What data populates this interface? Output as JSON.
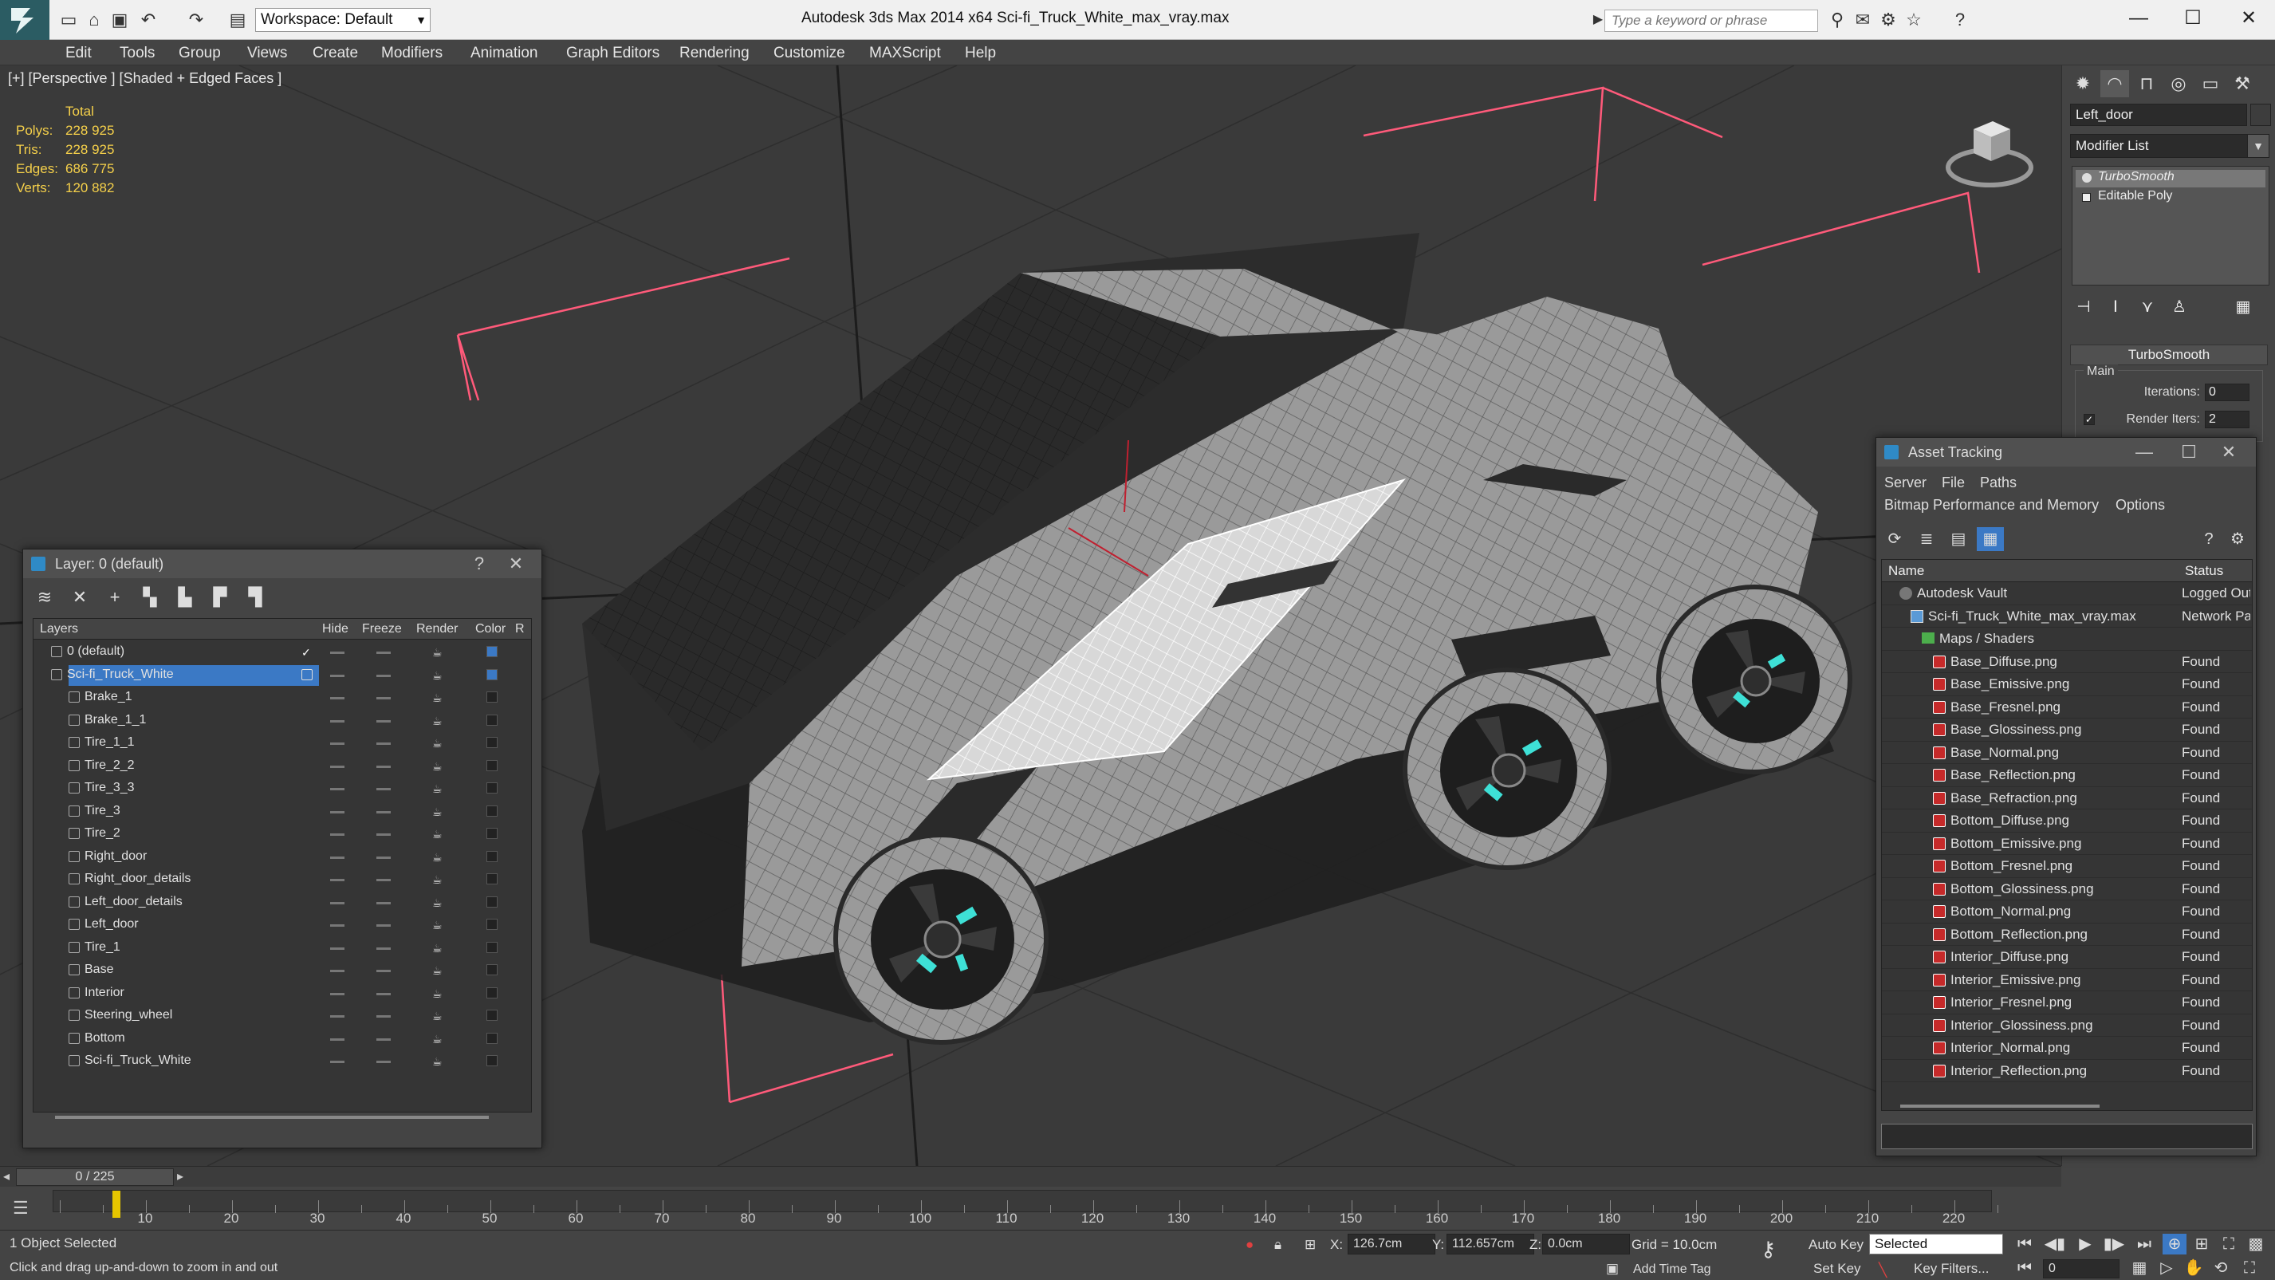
{
  "titlebar": {
    "workspace_label": "Workspace: Default",
    "title": "Autodesk 3ds Max  2014 x64       Sci-fi_Truck_White_max_vray.max",
    "search_placeholder": "Type a keyword or phrase"
  },
  "menu": [
    "Edit",
    "Tools",
    "Group",
    "Views",
    "Create",
    "Modifiers",
    "Animation",
    "Graph Editors",
    "Rendering",
    "Customize",
    "MAXScript",
    "Help"
  ],
  "viewport": {
    "label": "[+] [Perspective ] [Shaded + Edged Faces ]",
    "stats": {
      "header": "Total",
      "rows": [
        {
          "key": "Polys:",
          "value": "228 925"
        },
        {
          "key": "Tris:",
          "value": "228 925"
        },
        {
          "key": "Edges:",
          "value": "686 775"
        },
        {
          "key": "Verts:",
          "value": "120 882"
        }
      ]
    }
  },
  "command_panel": {
    "object_name": "Left_door",
    "modifier_list": "Modifier List",
    "stack": [
      {
        "label": "TurboSmooth",
        "selected": true
      },
      {
        "label": "Editable Poly",
        "selected": false
      }
    ],
    "rollout_title": "TurboSmooth",
    "group_label": "Main",
    "iterations_label": "Iterations:",
    "iterations_value": "0",
    "render_iters_label": "Render Iters:",
    "render_iters_value": "2"
  },
  "layers_dialog": {
    "title": "Layer: 0 (default)",
    "help": "?",
    "close": "✕",
    "columns": {
      "layers": "Layers",
      "hide": "Hide",
      "freeze": "Freeze",
      "render": "Render",
      "color": "Color",
      "radiosity": "R"
    },
    "rows": [
      {
        "name": "0 (default)",
        "level": 0
      },
      {
        "name": "Sci-fi_Truck_White",
        "level": 0,
        "selected": true
      },
      {
        "name": "Brake_1",
        "level": 1
      },
      {
        "name": "Brake_1_1",
        "level": 1
      },
      {
        "name": "Tire_1_1",
        "level": 1
      },
      {
        "name": "Tire_2_2",
        "level": 1
      },
      {
        "name": "Tire_3_3",
        "level": 1
      },
      {
        "name": "Tire_3",
        "level": 1
      },
      {
        "name": "Tire_2",
        "level": 1
      },
      {
        "name": "Right_door",
        "level": 1
      },
      {
        "name": "Right_door_details",
        "level": 1
      },
      {
        "name": "Left_door_details",
        "level": 1
      },
      {
        "name": "Left_door",
        "level": 1
      },
      {
        "name": "Tire_1",
        "level": 1
      },
      {
        "name": "Base",
        "level": 1
      },
      {
        "name": "Interior",
        "level": 1
      },
      {
        "name": "Steering_wheel",
        "level": 1
      },
      {
        "name": "Bottom",
        "level": 1
      },
      {
        "name": "Sci-fi_Truck_White",
        "level": 1
      }
    ]
  },
  "asset_dialog": {
    "title": "Asset Tracking",
    "menu": [
      "Server",
      "File",
      "Paths",
      "Bitmap Performance and Memory",
      "Options"
    ],
    "columns": {
      "name": "Name",
      "status": "Status"
    },
    "rows": [
      {
        "name": "Autodesk Vault",
        "status": "Logged Out",
        "level": 0,
        "kind": "vault"
      },
      {
        "name": "Sci-fi_Truck_White_max_vray.max",
        "status": "Network Path",
        "level": 1,
        "kind": "max"
      },
      {
        "name": "Maps / Shaders",
        "status": "",
        "level": 2,
        "kind": "folder"
      },
      {
        "name": "Base_Diffuse.png",
        "status": "Found",
        "level": 3,
        "kind": "file"
      },
      {
        "name": "Base_Emissive.png",
        "status": "Found",
        "level": 3,
        "kind": "file"
      },
      {
        "name": "Base_Fresnel.png",
        "status": "Found",
        "level": 3,
        "kind": "file"
      },
      {
        "name": "Base_Glossiness.png",
        "status": "Found",
        "level": 3,
        "kind": "file"
      },
      {
        "name": "Base_Normal.png",
        "status": "Found",
        "level": 3,
        "kind": "file"
      },
      {
        "name": "Base_Reflection.png",
        "status": "Found",
        "level": 3,
        "kind": "file"
      },
      {
        "name": "Base_Refraction.png",
        "status": "Found",
        "level": 3,
        "kind": "file"
      },
      {
        "name": "Bottom_Diffuse.png",
        "status": "Found",
        "level": 3,
        "kind": "file"
      },
      {
        "name": "Bottom_Emissive.png",
        "status": "Found",
        "level": 3,
        "kind": "file"
      },
      {
        "name": "Bottom_Fresnel.png",
        "status": "Found",
        "level": 3,
        "kind": "file"
      },
      {
        "name": "Bottom_Glossiness.png",
        "status": "Found",
        "level": 3,
        "kind": "file"
      },
      {
        "name": "Bottom_Normal.png",
        "status": "Found",
        "level": 3,
        "kind": "file"
      },
      {
        "name": "Bottom_Reflection.png",
        "status": "Found",
        "level": 3,
        "kind": "file"
      },
      {
        "name": "Interior_Diffuse.png",
        "status": "Found",
        "level": 3,
        "kind": "file"
      },
      {
        "name": "Interior_Emissive.png",
        "status": "Found",
        "level": 3,
        "kind": "file"
      },
      {
        "name": "Interior_Fresnel.png",
        "status": "Found",
        "level": 3,
        "kind": "file"
      },
      {
        "name": "Interior_Glossiness.png",
        "status": "Found",
        "level": 3,
        "kind": "file"
      },
      {
        "name": "Interior_Normal.png",
        "status": "Found",
        "level": 3,
        "kind": "file"
      },
      {
        "name": "Interior_Reflection.png",
        "status": "Found",
        "level": 3,
        "kind": "file"
      }
    ]
  },
  "timeline": {
    "frame_label": "0 / 225",
    "ticks": [
      "10",
      "20",
      "30",
      "40",
      "50",
      "60",
      "70",
      "80",
      "90",
      "100",
      "110",
      "120",
      "130",
      "140",
      "150",
      "160",
      "170",
      "180",
      "190",
      "200",
      "210",
      "220"
    ]
  },
  "status": {
    "selection": "1 Object Selected",
    "prompt": "Click and drag up-and-down to zoom in and out",
    "x_label": "X:",
    "x_value": "126.7cm",
    "y_label": "Y:",
    "y_value": "112.657cm",
    "z_label": "Z:",
    "z_value": "0.0cm",
    "grid": "Grid = 10.0cm",
    "add_time_tag": "Add Time Tag",
    "auto_key": "Auto Key",
    "set_key": "Set Key",
    "selected_option": "Selected",
    "key_filters": "Key Filters...",
    "frame_value": "0"
  },
  "colors": {
    "selection_blue": "#3b79c5",
    "stat_yellow": "#f5d04a",
    "bbox_red": "#ff5a7a",
    "hub_cyan": "#3ee0d6"
  }
}
